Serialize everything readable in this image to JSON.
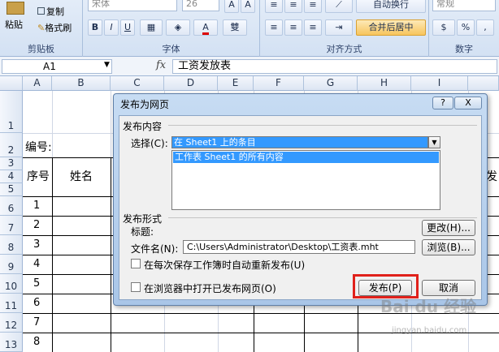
{
  "ribbon": {
    "paste_label": "粘贴",
    "copy_label": "复制",
    "format_painter_label": "格式刷",
    "clipboard_group": "剪贴板",
    "font_name": "宋体",
    "font_size": "26",
    "font_group": "字体",
    "align_group": "对齐方式",
    "wrap_text_label": "自动换行",
    "merge_center_label": "合并后居中",
    "number_format": "常规",
    "number_group": "数字",
    "bold": "B",
    "italic": "I",
    "underline": "U",
    "font_a": "A",
    "wen": "雙",
    "percent": "%",
    "comma": ","
  },
  "formula_bar": {
    "name_box": "A1",
    "fx": "fx",
    "content": "工资发放表"
  },
  "columns": [
    "A",
    "B",
    "C",
    "D",
    "E",
    "F",
    "G",
    "H",
    "I"
  ],
  "rows": [
    "1",
    "2",
    "3",
    "4",
    "5",
    "6",
    "7",
    "8",
    "9",
    "10",
    "11",
    "12",
    "13"
  ],
  "sheet": {
    "label_number": "编号:",
    "header_seq": "序号",
    "header_name": "姓名",
    "seq_values": [
      "1",
      "2",
      "3",
      "4",
      "5",
      "6",
      "7",
      "8"
    ],
    "cut_right": "发"
  },
  "dialog": {
    "title": "发布为网页",
    "help": "?",
    "close": "X",
    "section_content": "发布内容",
    "select_label": "选择(C):",
    "select_value": "在 Sheet1 上的条目",
    "list_item": "工作表        Sheet1 的所有内容",
    "section_form": "发布形式",
    "title_label": "标题:",
    "change_button": "更改(H)...",
    "filename_label": "文件名(N):",
    "filename_value": "C:\\Users\\Administrator\\Desktop\\工资表.mht",
    "browse_button": "浏览(B)...",
    "autorepublish_label": "在每次保存工作簿时自动重新发布(U)",
    "open_in_browser_label": "在浏览器中打开已发布网页(O)",
    "publish_button": "发布(P)",
    "cancel_button": "取消"
  },
  "watermark": {
    "brand": "Bai du 经验",
    "url": "jingyan.baidu.com"
  }
}
